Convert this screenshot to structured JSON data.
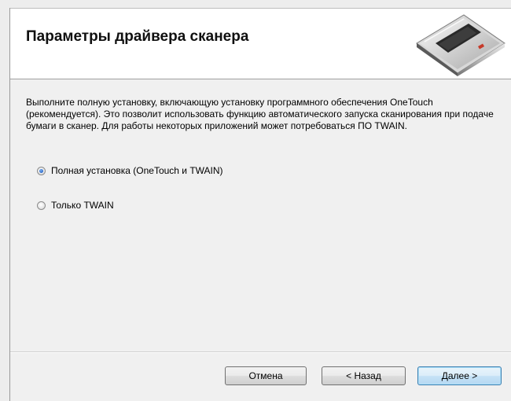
{
  "header": {
    "title": "Параметры драйвера сканера",
    "icon": "scanner-icon"
  },
  "content": {
    "description": "Выполните полную установку, включающую установку программного обеспечения OneTouch (рекомендуется). Это позволит использовать функцию автоматического запуска сканирования при подаче бумаги в сканер. Для работы некоторых приложений может потребоваться ПО TWAIN.",
    "options": [
      {
        "label": "Полная установка (OneTouch и TWAIN)",
        "selected": true
      },
      {
        "label": "Только TWAIN",
        "selected": false
      }
    ]
  },
  "buttons": {
    "cancel": "Отмена",
    "back": "< Назад",
    "next": "Далее >"
  }
}
